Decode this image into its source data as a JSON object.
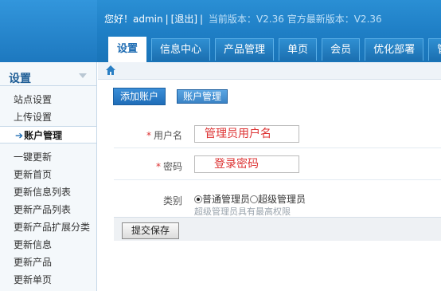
{
  "header": {
    "greeting": "您好！",
    "user": "admin",
    "logout": "[退出]",
    "current_version_label": "当前版本：",
    "current_version": "V2.36",
    "latest_version_label": "官方最新版本：",
    "latest_version": "V2.36"
  },
  "tabs": [
    "设置",
    "信息中心",
    "产品管理",
    "单页",
    "会员",
    "优化部署",
    "管"
  ],
  "sidebar": {
    "title": "设置",
    "group1": [
      "站点设置",
      "上传设置"
    ],
    "active_item": "账户管理",
    "active_marker": "➔",
    "group2": [
      "一键更新",
      "更新首页",
      "更新信息列表",
      "更新产品列表",
      "更新产品扩展分类",
      "更新信息",
      "更新产品",
      "更新单页"
    ]
  },
  "toolbar": {
    "add_account": "添加账户",
    "account_manage": "账户管理"
  },
  "form": {
    "username_required": "*",
    "username_label": "用户名",
    "username_value": "管理员用户名",
    "password_required": "*",
    "password_label": "密码",
    "password_value": "登录密码",
    "role_label": "类别",
    "role_options": [
      "普通管理员",
      "超级管理员"
    ],
    "role_selected": "普通管理员",
    "role_hint": "超级管理员具有最高权限",
    "submit": "提交保存"
  },
  "colors": {
    "header_blue": "#1f7fc6",
    "tab_active_text": "#1f6db3",
    "field_text": "#dd3333"
  }
}
